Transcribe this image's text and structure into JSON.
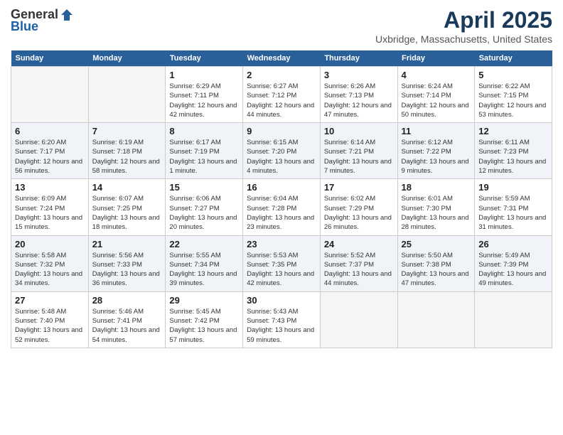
{
  "header": {
    "logo_general": "General",
    "logo_blue": "Blue",
    "month": "April 2025",
    "location": "Uxbridge, Massachusetts, United States"
  },
  "days_of_week": [
    "Sunday",
    "Monday",
    "Tuesday",
    "Wednesday",
    "Thursday",
    "Friday",
    "Saturday"
  ],
  "weeks": [
    [
      {
        "num": "",
        "sunrise": "",
        "sunset": "",
        "daylight": ""
      },
      {
        "num": "",
        "sunrise": "",
        "sunset": "",
        "daylight": ""
      },
      {
        "num": "1",
        "sunrise": "Sunrise: 6:29 AM",
        "sunset": "Sunset: 7:11 PM",
        "daylight": "Daylight: 12 hours and 42 minutes."
      },
      {
        "num": "2",
        "sunrise": "Sunrise: 6:27 AM",
        "sunset": "Sunset: 7:12 PM",
        "daylight": "Daylight: 12 hours and 44 minutes."
      },
      {
        "num": "3",
        "sunrise": "Sunrise: 6:26 AM",
        "sunset": "Sunset: 7:13 PM",
        "daylight": "Daylight: 12 hours and 47 minutes."
      },
      {
        "num": "4",
        "sunrise": "Sunrise: 6:24 AM",
        "sunset": "Sunset: 7:14 PM",
        "daylight": "Daylight: 12 hours and 50 minutes."
      },
      {
        "num": "5",
        "sunrise": "Sunrise: 6:22 AM",
        "sunset": "Sunset: 7:15 PM",
        "daylight": "Daylight: 12 hours and 53 minutes."
      }
    ],
    [
      {
        "num": "6",
        "sunrise": "Sunrise: 6:20 AM",
        "sunset": "Sunset: 7:17 PM",
        "daylight": "Daylight: 12 hours and 56 minutes."
      },
      {
        "num": "7",
        "sunrise": "Sunrise: 6:19 AM",
        "sunset": "Sunset: 7:18 PM",
        "daylight": "Daylight: 12 hours and 58 minutes."
      },
      {
        "num": "8",
        "sunrise": "Sunrise: 6:17 AM",
        "sunset": "Sunset: 7:19 PM",
        "daylight": "Daylight: 13 hours and 1 minute."
      },
      {
        "num": "9",
        "sunrise": "Sunrise: 6:15 AM",
        "sunset": "Sunset: 7:20 PM",
        "daylight": "Daylight: 13 hours and 4 minutes."
      },
      {
        "num": "10",
        "sunrise": "Sunrise: 6:14 AM",
        "sunset": "Sunset: 7:21 PM",
        "daylight": "Daylight: 13 hours and 7 minutes."
      },
      {
        "num": "11",
        "sunrise": "Sunrise: 6:12 AM",
        "sunset": "Sunset: 7:22 PM",
        "daylight": "Daylight: 13 hours and 9 minutes."
      },
      {
        "num": "12",
        "sunrise": "Sunrise: 6:11 AM",
        "sunset": "Sunset: 7:23 PM",
        "daylight": "Daylight: 13 hours and 12 minutes."
      }
    ],
    [
      {
        "num": "13",
        "sunrise": "Sunrise: 6:09 AM",
        "sunset": "Sunset: 7:24 PM",
        "daylight": "Daylight: 13 hours and 15 minutes."
      },
      {
        "num": "14",
        "sunrise": "Sunrise: 6:07 AM",
        "sunset": "Sunset: 7:25 PM",
        "daylight": "Daylight: 13 hours and 18 minutes."
      },
      {
        "num": "15",
        "sunrise": "Sunrise: 6:06 AM",
        "sunset": "Sunset: 7:27 PM",
        "daylight": "Daylight: 13 hours and 20 minutes."
      },
      {
        "num": "16",
        "sunrise": "Sunrise: 6:04 AM",
        "sunset": "Sunset: 7:28 PM",
        "daylight": "Daylight: 13 hours and 23 minutes."
      },
      {
        "num": "17",
        "sunrise": "Sunrise: 6:02 AM",
        "sunset": "Sunset: 7:29 PM",
        "daylight": "Daylight: 13 hours and 26 minutes."
      },
      {
        "num": "18",
        "sunrise": "Sunrise: 6:01 AM",
        "sunset": "Sunset: 7:30 PM",
        "daylight": "Daylight: 13 hours and 28 minutes."
      },
      {
        "num": "19",
        "sunrise": "Sunrise: 5:59 AM",
        "sunset": "Sunset: 7:31 PM",
        "daylight": "Daylight: 13 hours and 31 minutes."
      }
    ],
    [
      {
        "num": "20",
        "sunrise": "Sunrise: 5:58 AM",
        "sunset": "Sunset: 7:32 PM",
        "daylight": "Daylight: 13 hours and 34 minutes."
      },
      {
        "num": "21",
        "sunrise": "Sunrise: 5:56 AM",
        "sunset": "Sunset: 7:33 PM",
        "daylight": "Daylight: 13 hours and 36 minutes."
      },
      {
        "num": "22",
        "sunrise": "Sunrise: 5:55 AM",
        "sunset": "Sunset: 7:34 PM",
        "daylight": "Daylight: 13 hours and 39 minutes."
      },
      {
        "num": "23",
        "sunrise": "Sunrise: 5:53 AM",
        "sunset": "Sunset: 7:35 PM",
        "daylight": "Daylight: 13 hours and 42 minutes."
      },
      {
        "num": "24",
        "sunrise": "Sunrise: 5:52 AM",
        "sunset": "Sunset: 7:37 PM",
        "daylight": "Daylight: 13 hours and 44 minutes."
      },
      {
        "num": "25",
        "sunrise": "Sunrise: 5:50 AM",
        "sunset": "Sunset: 7:38 PM",
        "daylight": "Daylight: 13 hours and 47 minutes."
      },
      {
        "num": "26",
        "sunrise": "Sunrise: 5:49 AM",
        "sunset": "Sunset: 7:39 PM",
        "daylight": "Daylight: 13 hours and 49 minutes."
      }
    ],
    [
      {
        "num": "27",
        "sunrise": "Sunrise: 5:48 AM",
        "sunset": "Sunset: 7:40 PM",
        "daylight": "Daylight: 13 hours and 52 minutes."
      },
      {
        "num": "28",
        "sunrise": "Sunrise: 5:46 AM",
        "sunset": "Sunset: 7:41 PM",
        "daylight": "Daylight: 13 hours and 54 minutes."
      },
      {
        "num": "29",
        "sunrise": "Sunrise: 5:45 AM",
        "sunset": "Sunset: 7:42 PM",
        "daylight": "Daylight: 13 hours and 57 minutes."
      },
      {
        "num": "30",
        "sunrise": "Sunrise: 5:43 AM",
        "sunset": "Sunset: 7:43 PM",
        "daylight": "Daylight: 13 hours and 59 minutes."
      },
      {
        "num": "",
        "sunrise": "",
        "sunset": "",
        "daylight": ""
      },
      {
        "num": "",
        "sunrise": "",
        "sunset": "",
        "daylight": ""
      },
      {
        "num": "",
        "sunrise": "",
        "sunset": "",
        "daylight": ""
      }
    ]
  ]
}
